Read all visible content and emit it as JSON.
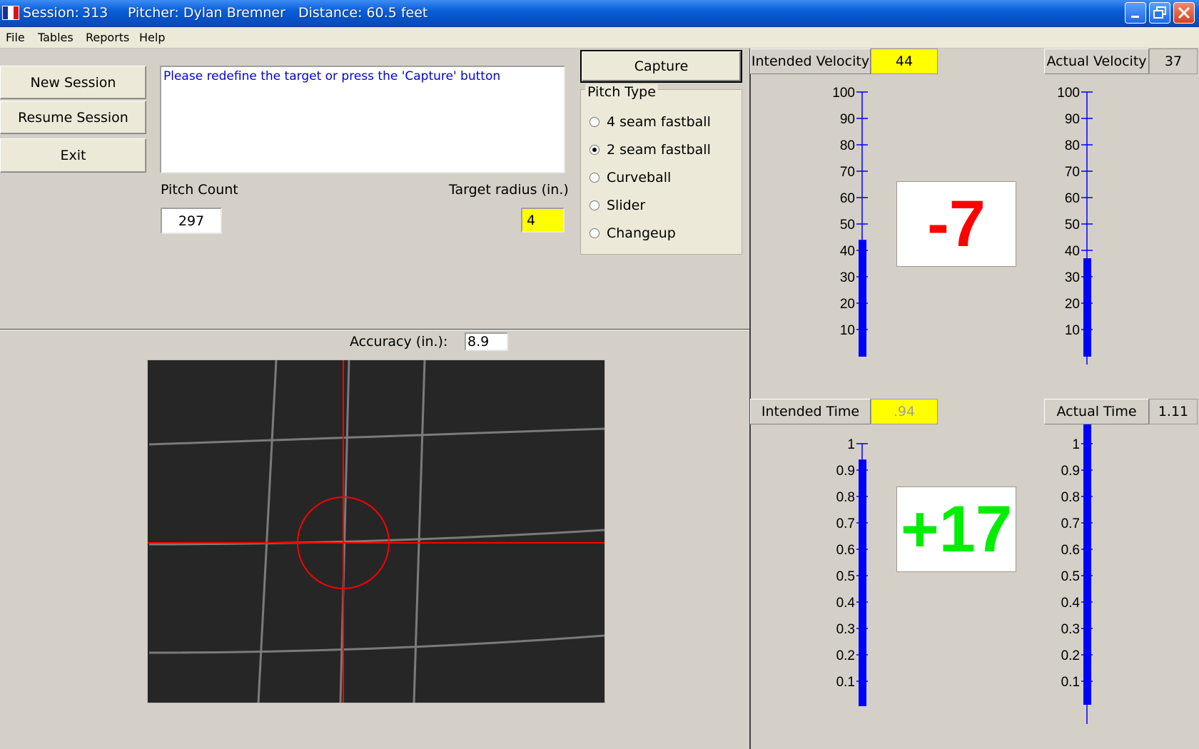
{
  "titlebar": {
    "session_label": "Session:",
    "session_value": "313",
    "pitcher": "Pitcher: Dylan Bremner",
    "distance": "Distance: 60.5 feet"
  },
  "menu": {
    "items": [
      "File",
      "Tables",
      "Reports",
      "Help"
    ]
  },
  "buttons": {
    "new_session": "New Session",
    "resume_session": "Resume Session",
    "exit": "Exit",
    "capture": "Capture"
  },
  "message": "Please redefine the target or press the 'Capture' button",
  "pitch_count": {
    "label": "Pitch Count",
    "value": "297"
  },
  "target_radius": {
    "label": "Target radius (in.)",
    "value": "4"
  },
  "pitch_type": {
    "label": "Pitch Type",
    "options": [
      "4 seam fastball",
      "2 seam fastball",
      "Curveball",
      "Slider",
      "Changeup"
    ],
    "selected": "2 seam fastball"
  },
  "accuracy": {
    "label": "Accuracy (in.):",
    "value": "8.9"
  },
  "velocity": {
    "intended_label": "Intended Velocity",
    "intended_value": "44",
    "actual_label": "Actual Velocity",
    "actual_value": "37",
    "delta": "-7",
    "delta_color": "#ff0000",
    "ticks": [
      "100",
      "90",
      "80",
      "70",
      "60",
      "50",
      "40",
      "30",
      "20",
      "10"
    ],
    "intended_level": 44,
    "actual_level": 37,
    "scale_max": 100
  },
  "time": {
    "intended_label": "Intended Time",
    "intended_value": ".94",
    "actual_label": "Actual Time",
    "actual_value": "1.11",
    "delta": "+17",
    "delta_color": "#00ee00",
    "ticks": [
      "1",
      "0.9",
      "0.8",
      "0.7",
      "0.6",
      "0.5",
      "0.4",
      "0.3",
      "0.2",
      "0.1"
    ],
    "intended_level": 0.94,
    "actual_level": 1.11,
    "scale_max": 1
  },
  "colors": {
    "title_bar": "#0653c8",
    "bar_fill": "#0000ff",
    "highlight": "#ffff00",
    "crosshair": "#ff0000"
  }
}
